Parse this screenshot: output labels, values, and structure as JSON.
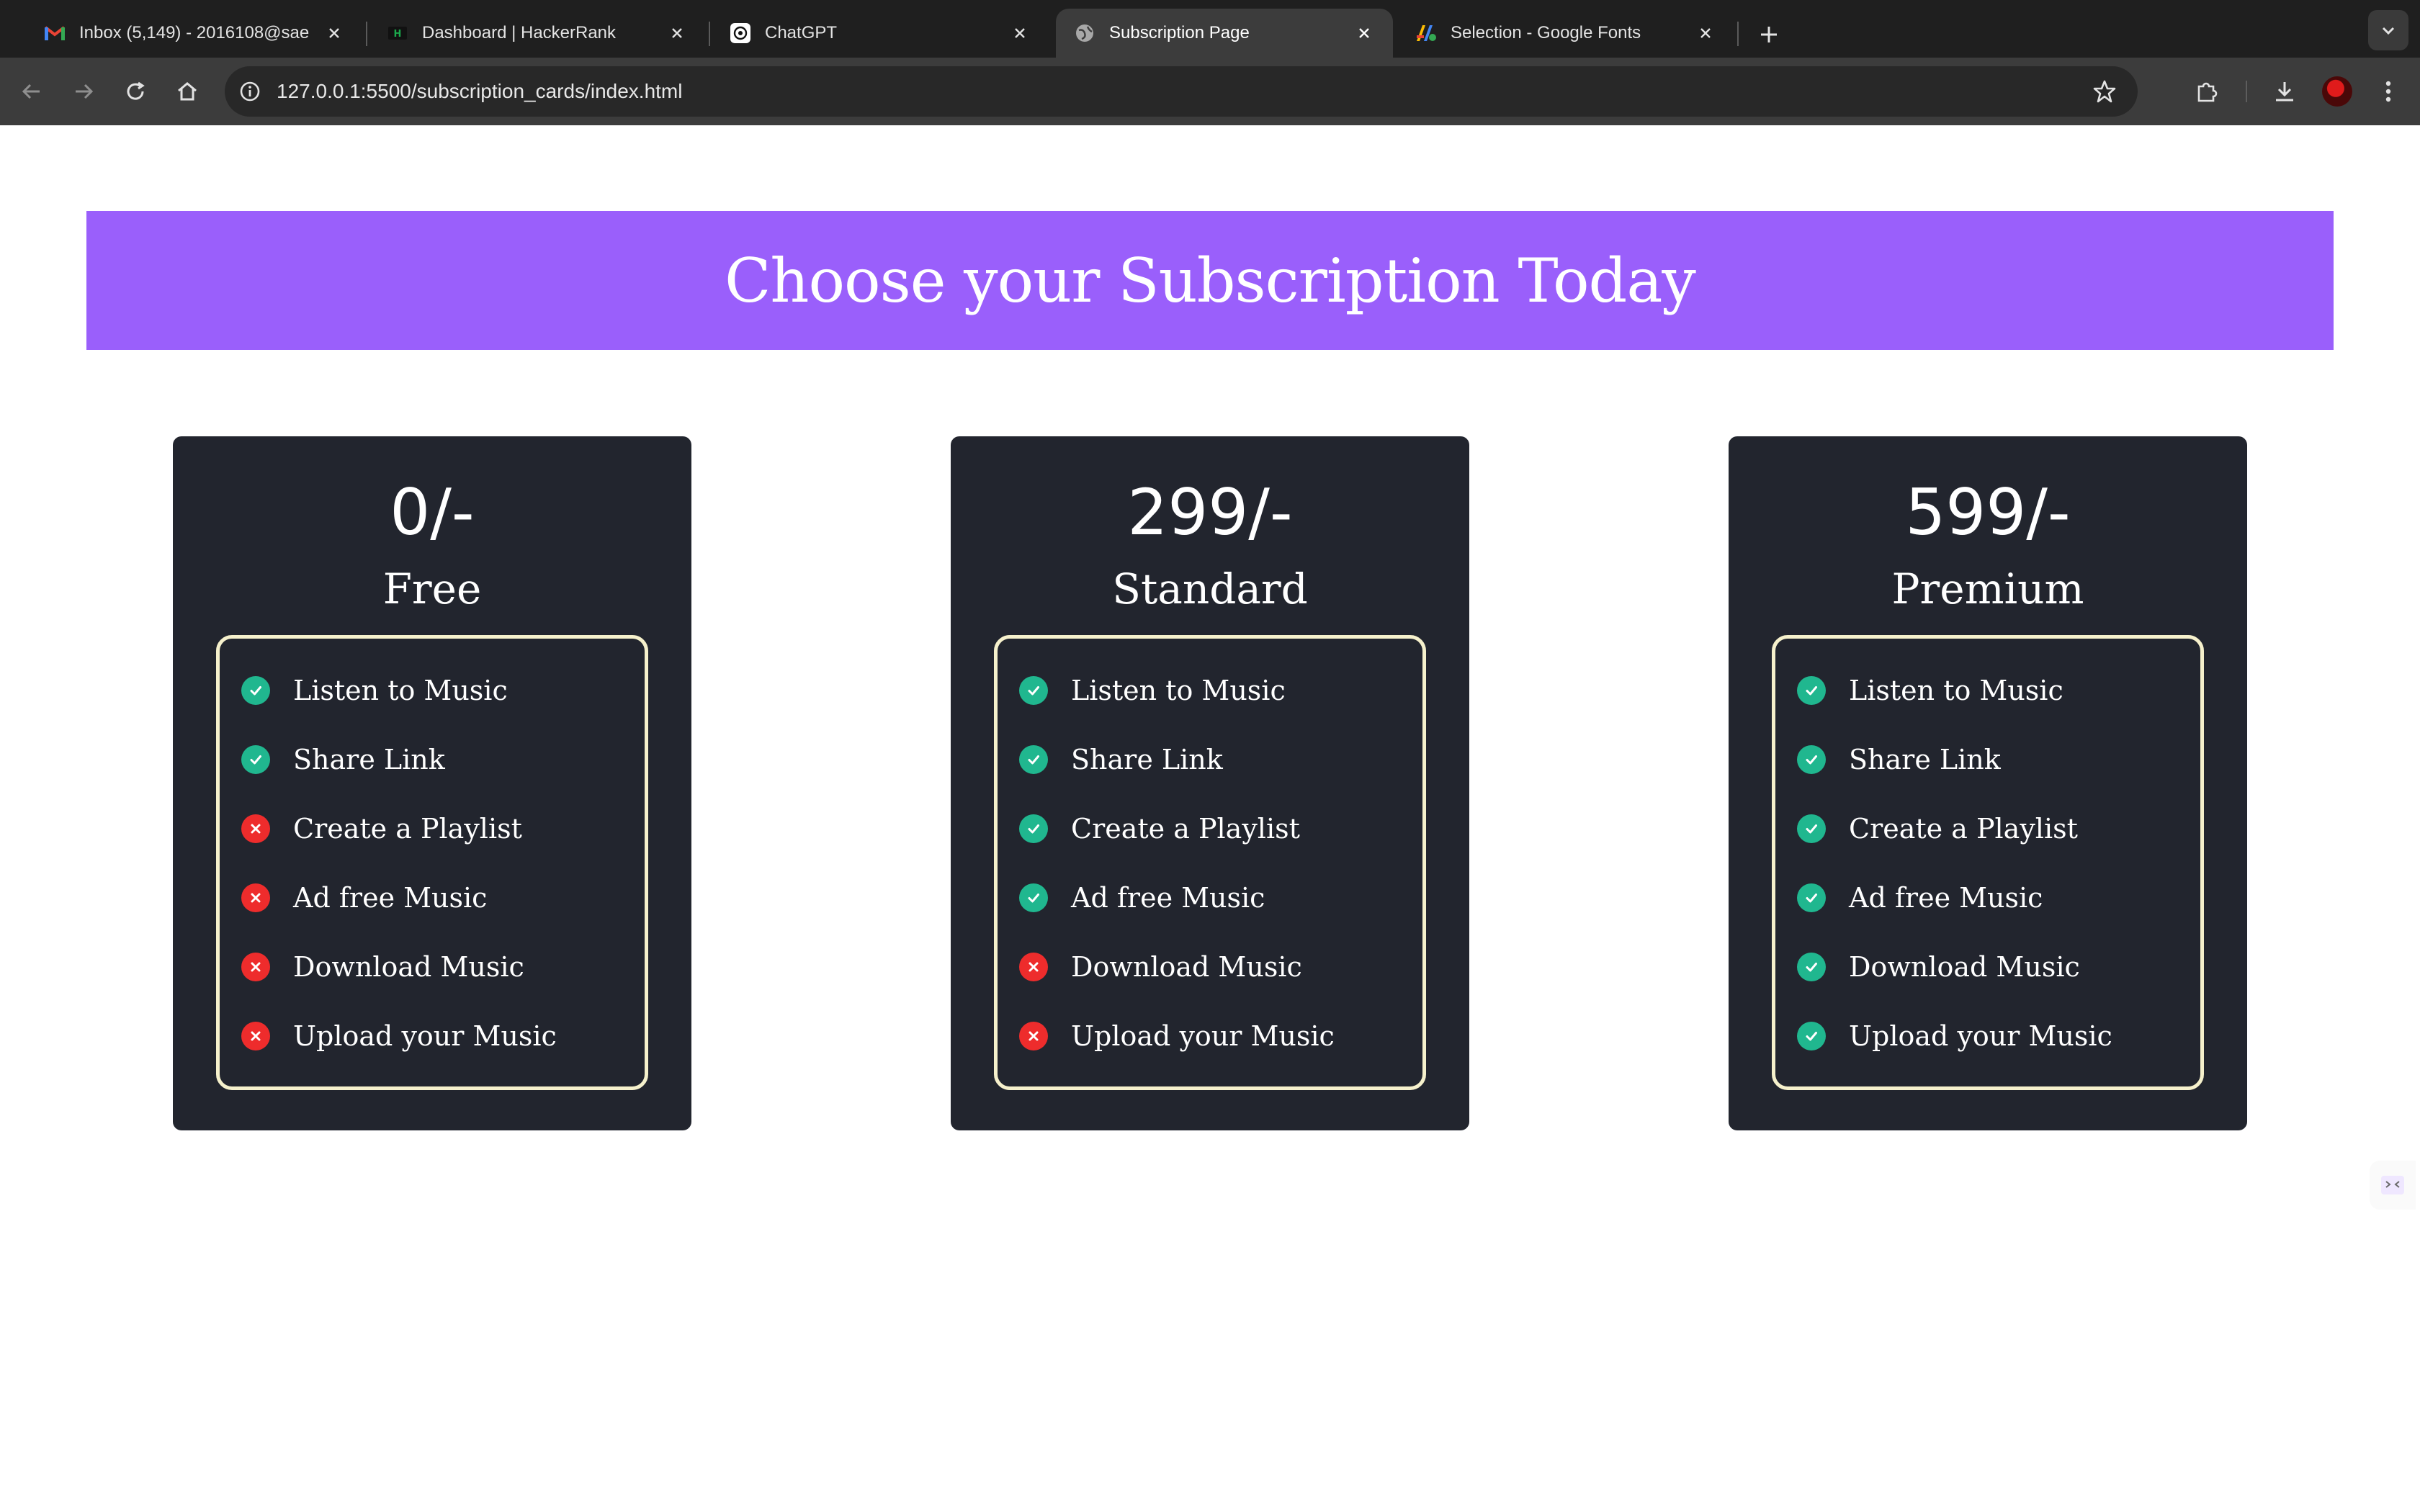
{
  "browser": {
    "tabs": [
      {
        "title": "Inbox (5,149) - 2016108@sae",
        "icon": "gmail-icon",
        "active": false
      },
      {
        "title": "Dashboard | HackerRank",
        "icon": "hackerrank-icon",
        "active": false
      },
      {
        "title": "ChatGPT",
        "icon": "chatgpt-icon",
        "active": false
      },
      {
        "title": "Subscription Page",
        "icon": "globe-icon",
        "active": true
      },
      {
        "title": "Selection - Google Fonts",
        "icon": "google-fonts-icon",
        "active": false
      }
    ],
    "url": "127.0.0.1:5500/subscription_cards/index.html"
  },
  "page": {
    "heading": "Choose your Subscription Today",
    "accent_color": "#9a5ffb",
    "card_color": "#22252e",
    "check_color": "#20b78f",
    "cross_color": "#ee2c2c",
    "plans": [
      {
        "price": "0/-",
        "name": "Free",
        "features": [
          {
            "label": "Listen to Music",
            "included": true
          },
          {
            "label": "Share Link",
            "included": true
          },
          {
            "label": "Create a Playlist",
            "included": false
          },
          {
            "label": "Ad free Music",
            "included": false
          },
          {
            "label": "Download Music",
            "included": false
          },
          {
            "label": "Upload your Music",
            "included": false
          }
        ]
      },
      {
        "price": "299/-",
        "name": "Standard",
        "features": [
          {
            "label": "Listen to Music",
            "included": true
          },
          {
            "label": "Share Link",
            "included": true
          },
          {
            "label": "Create a Playlist",
            "included": true
          },
          {
            "label": "Ad free Music",
            "included": true
          },
          {
            "label": "Download Music",
            "included": false
          },
          {
            "label": "Upload your Music",
            "included": false
          }
        ]
      },
      {
        "price": "599/-",
        "name": "Premium",
        "features": [
          {
            "label": "Listen to Music",
            "included": true
          },
          {
            "label": "Share Link",
            "included": true
          },
          {
            "label": "Create a Playlist",
            "included": true
          },
          {
            "label": "Ad free Music",
            "included": true
          },
          {
            "label": "Download Music",
            "included": true
          },
          {
            "label": "Upload your Music",
            "included": true
          }
        ]
      }
    ]
  }
}
